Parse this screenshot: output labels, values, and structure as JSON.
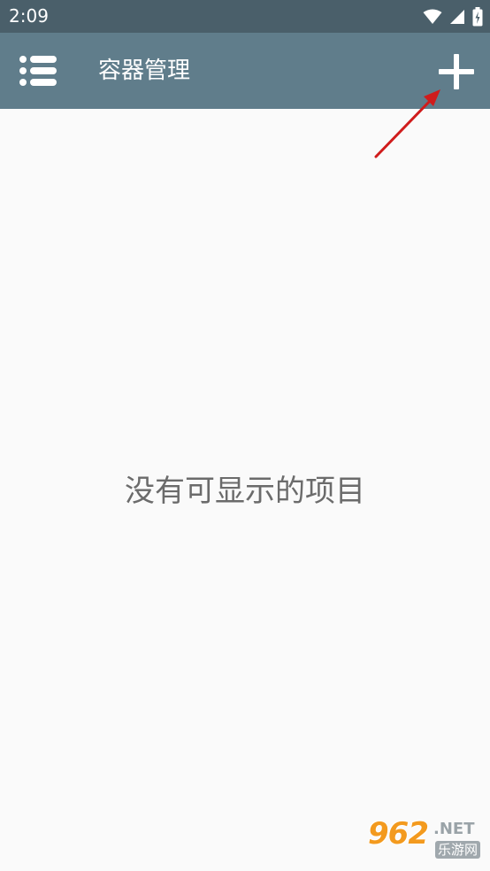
{
  "status_bar": {
    "time": "2:09",
    "icons": [
      "wifi-icon",
      "signal-icon",
      "battery-icon"
    ]
  },
  "app_bar": {
    "menu_icon": "list-menu-icon",
    "title": "容器管理",
    "add_icon": "plus-icon",
    "background_color": "#607d8b"
  },
  "content": {
    "empty_message": "没有可显示的项目"
  },
  "annotation": {
    "arrow_color": "#d01c1c"
  },
  "watermark": {
    "number": "962",
    "suffix": ".NET",
    "subtitle": "乐游网"
  }
}
